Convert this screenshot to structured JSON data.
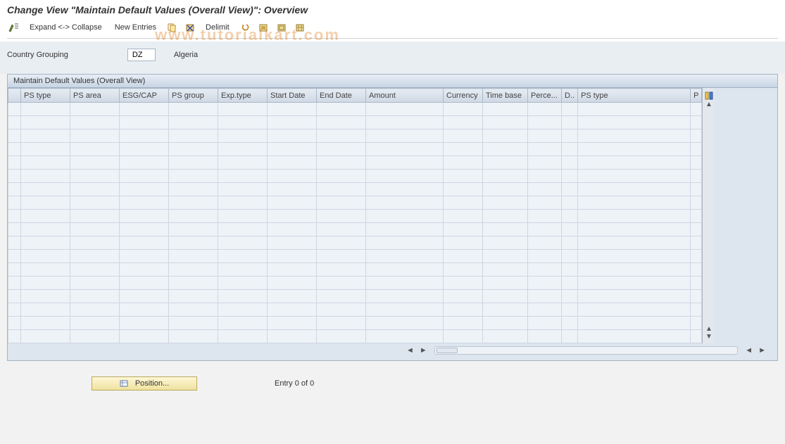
{
  "header": {
    "title": "Change View \"Maintain Default Values (Overall View)\": Overview"
  },
  "toolbar": {
    "expand_collapse_label": "Expand <-> Collapse",
    "new_entries_label": "New Entries",
    "delimit_label": "Delimit"
  },
  "selection": {
    "country_grouping_label": "Country Grouping",
    "country_grouping_value": "DZ",
    "country_grouping_text": "Algeria"
  },
  "group": {
    "title": "Maintain Default Values (Overall View)"
  },
  "columns": [
    "PS type",
    "PS area",
    "ESG/CAP",
    "PS group",
    "Exp.type",
    "Start Date",
    "End Date",
    "Amount",
    "Currency",
    "Time base",
    "Perce...",
    "D..",
    "PS type",
    "P"
  ],
  "row_count": 18,
  "footer": {
    "position_label": "Position...",
    "entry_text": "Entry 0 of 0"
  },
  "watermark": "www.tutorialkart.com"
}
